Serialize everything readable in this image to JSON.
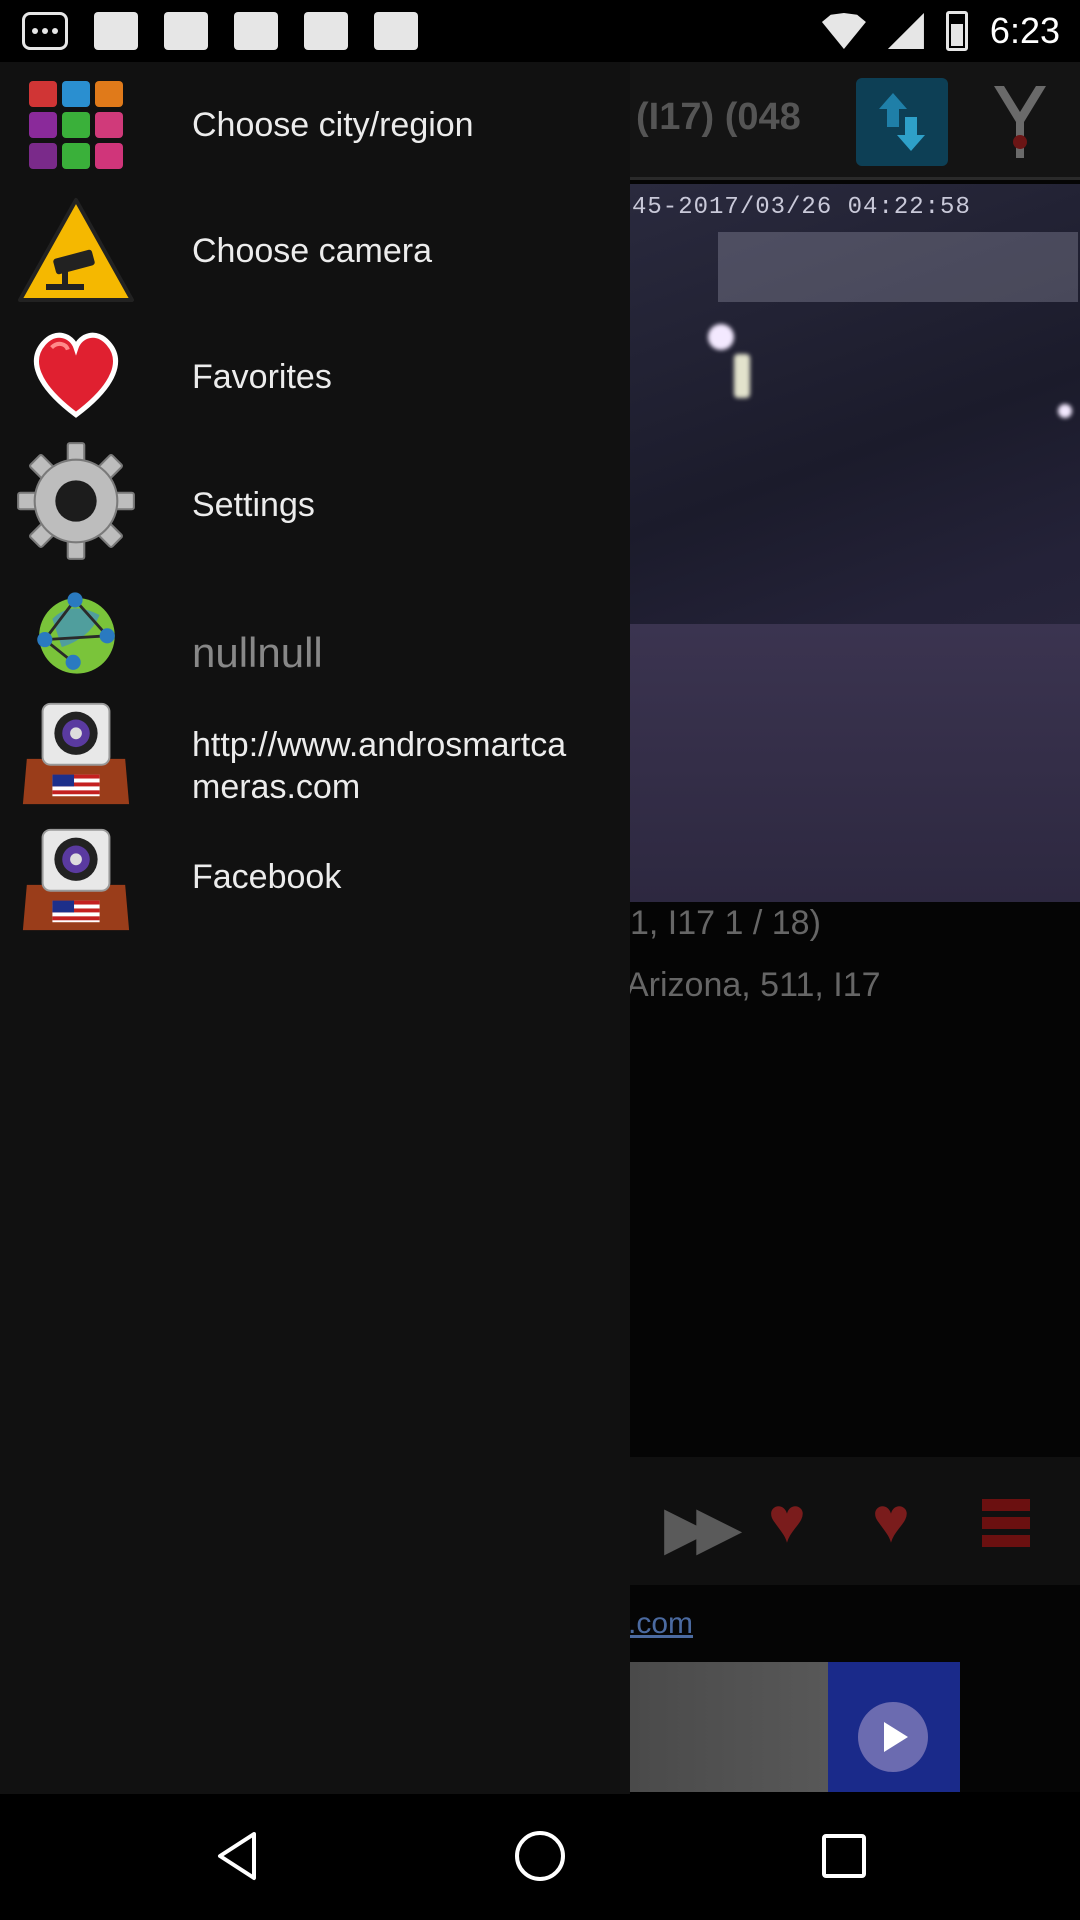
{
  "status_bar": {
    "time": "6:23",
    "icons": [
      "notification-dots-icon",
      "flipboard-icon",
      "photo-icon",
      "photo-icon",
      "flipboard-icon",
      "photo-icon",
      "wifi-icon",
      "signal-icon",
      "battery-icon"
    ]
  },
  "app": {
    "title": "(I17) (048",
    "camera_timestamp": "45-2017/03/26 04:22:58",
    "info_line_1": "1, I17 1 / 18)",
    "info_line_2": "Arizona, 511, I17",
    "ad_link": ".com",
    "colors": {
      "header_bg": "#141414",
      "refresh_bg": "#0d3f55"
    }
  },
  "drawer": {
    "items": [
      {
        "label": "Choose city/region",
        "icon": "region-grid-icon"
      },
      {
        "label": "Choose camera",
        "icon": "camera-warning-sign-icon"
      },
      {
        "label": "Favorites",
        "icon": "heart-icon"
      },
      {
        "label": "Settings",
        "icon": "gear-icon"
      },
      {
        "label": "nullnull",
        "icon": "globe-network-icon"
      },
      {
        "label": "http://www.androsmartcameras.com",
        "line1": "http://www.androsmartca",
        "line2": "meras.com",
        "icon": "usa-camera-icon"
      },
      {
        "label": "Facebook",
        "icon": "usa-camera-icon"
      }
    ]
  },
  "nav_bar": {
    "buttons": [
      "back-icon",
      "home-icon",
      "recents-icon"
    ]
  }
}
